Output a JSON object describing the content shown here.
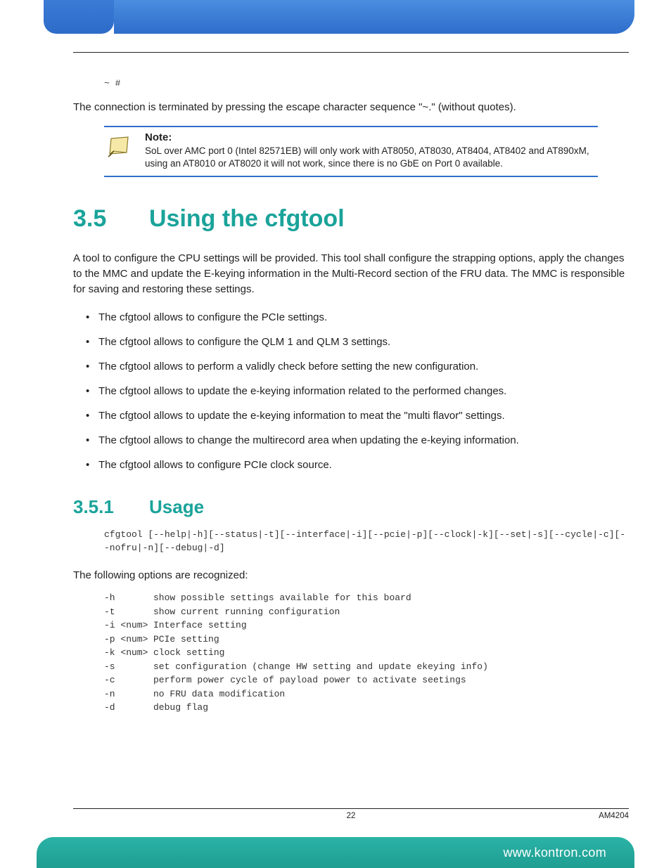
{
  "prompt": "~ #",
  "intro_line": "The connection is terminated by pressing the escape character sequence \"~.\" (without quotes).",
  "note": {
    "title": "Note:",
    "text": "SoL over AMC port 0 (Intel 82571EB) will only work with AT8050, AT8030, AT8404, AT8402 and AT890xM,  using an AT8010 or AT8020 it will not work, since there is no GbE on Port 0 available."
  },
  "section": {
    "number": "3.5",
    "title": "Using the cfgtool",
    "paragraph": "A tool to configure the CPU settings will be provided. This tool shall configure the strapping options, apply the changes to the MMC and update the E-keying information in the Multi-Record section of the FRU data. The MMC is responsible for saving and restoring these settings.",
    "bullets": [
      "The cfgtool allows to configure the PCIe settings.",
      "The cfgtool allows to configure the QLM 1 and QLM 3 settings.",
      "The cfgtool allows to perform a validly check before setting the new configuration.",
      "The cfgtool allows to update the e-keying information related to the performed changes.",
      "The cfgtool allows to update the e-keying information to meat the \"multi flavor\" settings.",
      "The cfgtool allows to change the multirecord area when updating the e-keying information.",
      "The cfgtool allows to configure PCIe clock source."
    ]
  },
  "subsection": {
    "number": "3.5.1",
    "title": "Usage",
    "usage_cmd": "cfgtool [--help|-h][--status|-t][--interface|-i][--pcie|-p][--clock|-k][--set|-s][--cycle|-c][--nofru|-n][--debug|-d]",
    "options_intro": "The following options are recognized:",
    "options": [
      {
        "flag": "-h",
        "desc": "show possible settings available for this board"
      },
      {
        "flag": "-t",
        "desc": "show current running configuration"
      },
      {
        "flag": "-i <num>",
        "desc": "Interface setting"
      },
      {
        "flag": "-p <num>",
        "desc": "PCIe setting"
      },
      {
        "flag": "-k <num>",
        "desc": "clock setting"
      },
      {
        "flag": "-s",
        "desc": "set configuration (change HW setting and update ekeying info)"
      },
      {
        "flag": "-c",
        "desc": "perform power cycle of payload power to activate seetings"
      },
      {
        "flag": "-n",
        "desc": "no FRU data modification"
      },
      {
        "flag": "-d",
        "desc": "debug flag"
      }
    ]
  },
  "footer": {
    "page": "22",
    "doc": "AM4204",
    "url": "www.kontron.com"
  }
}
